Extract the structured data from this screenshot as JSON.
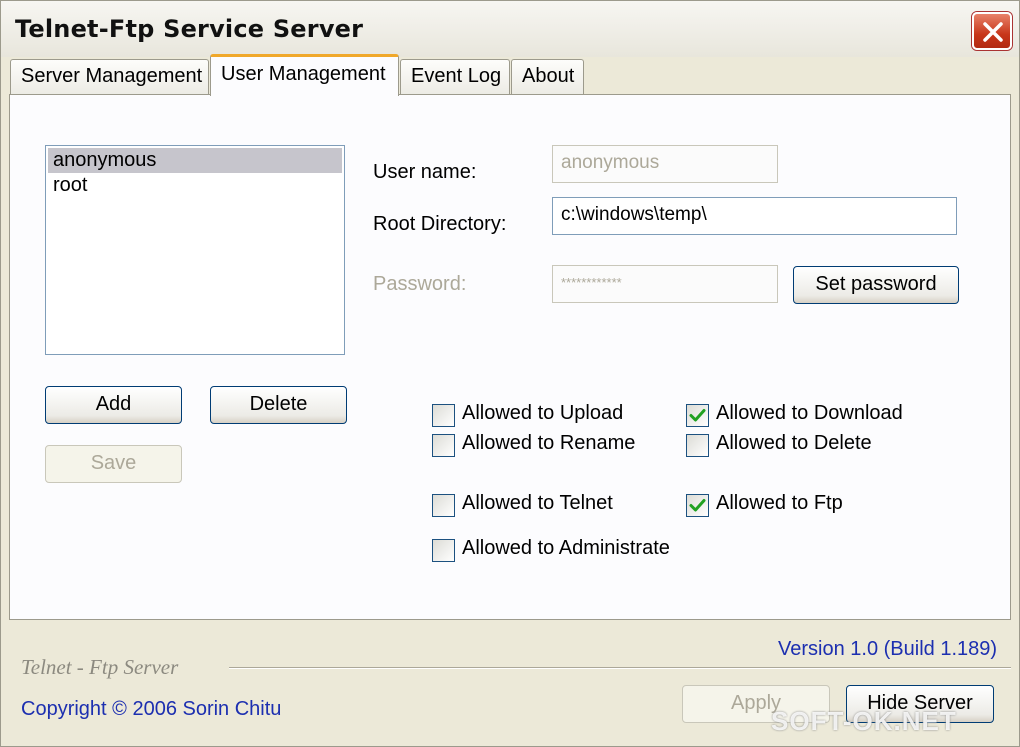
{
  "window": {
    "title": "Telnet-Ftp Service Server"
  },
  "tabs": [
    "Server Management",
    "User Management",
    "Event Log",
    "About"
  ],
  "users": [
    "anonymous",
    "root"
  ],
  "buttons": {
    "add": "Add",
    "delete": "Delete",
    "save": "Save",
    "set_password": "Set password",
    "apply": "Apply",
    "hide_server": "Hide Server"
  },
  "form": {
    "username_label": "User name:",
    "username_value": "anonymous",
    "rootdir_label": "Root Directory:",
    "rootdir_value": "c:\\windows\\temp\\",
    "password_label": "Password:",
    "password_value": "************"
  },
  "permissions": [
    {
      "label": "Allowed to Upload",
      "checked": false
    },
    {
      "label": "Allowed to Download",
      "checked": true
    },
    {
      "label": "Allowed to Rename",
      "checked": false
    },
    {
      "label": "Allowed to Delete",
      "checked": false
    },
    {
      "label": "Allowed to Telnet",
      "checked": false
    },
    {
      "label": "Allowed to Ftp",
      "checked": true
    },
    {
      "label": "Allowed to Administrate",
      "checked": false
    }
  ],
  "footer": {
    "brand": "Telnet - Ftp Server",
    "version": "Version 1.0 (Build 1.189)",
    "copyright": "Copyright © 2006 Sorin Chitu"
  },
  "watermark": "SOFT-OK.NET"
}
